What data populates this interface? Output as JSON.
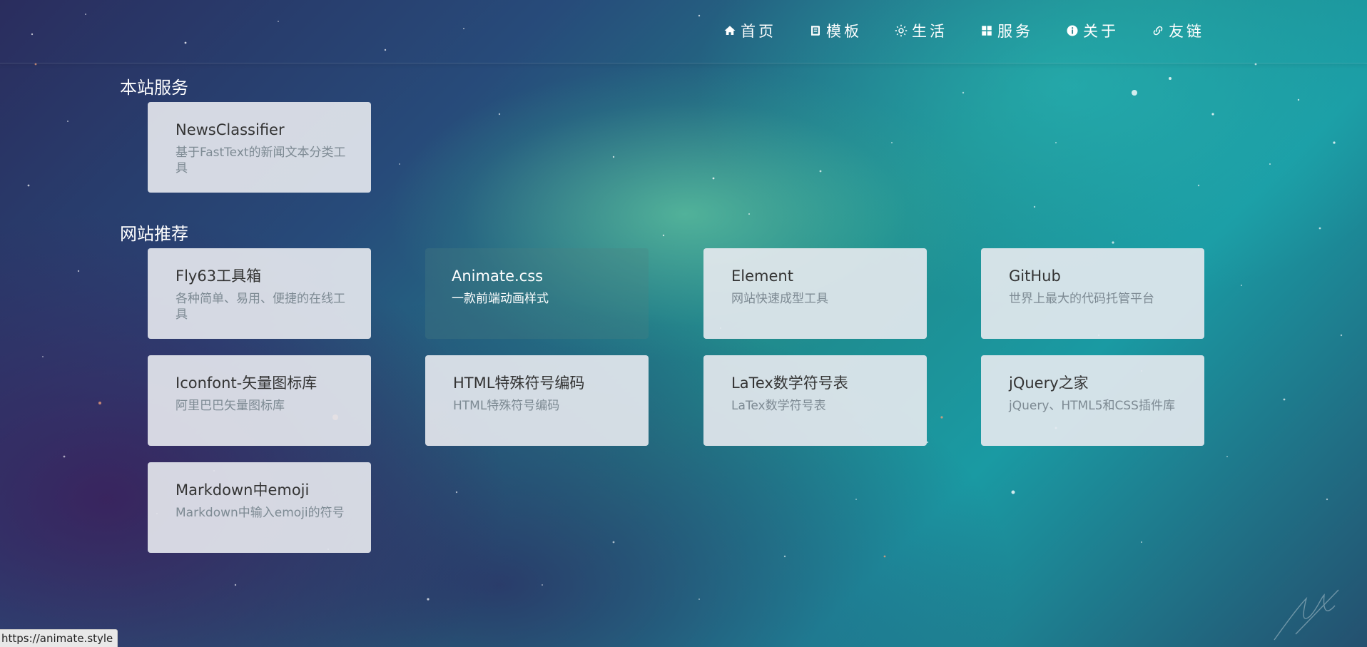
{
  "nav": [
    {
      "label": "首页",
      "icon": "home-icon"
    },
    {
      "label": "模板",
      "icon": "template-icon"
    },
    {
      "label": "生活",
      "icon": "sun-icon"
    },
    {
      "label": "服务",
      "icon": "grid-icon"
    },
    {
      "label": "关于",
      "icon": "info-icon"
    },
    {
      "label": "友链",
      "icon": "link-icon"
    }
  ],
  "sections": {
    "own": {
      "title": "本站服务",
      "cards": [
        {
          "title": "NewsClassifier",
          "desc": "基于FastText的新闻文本分类工具"
        }
      ]
    },
    "recommend": {
      "title": "网站推荐",
      "cards": [
        {
          "title": "Fly63工具箱",
          "desc": "各种简单、易用、便捷的在线工具"
        },
        {
          "title": "Animate.css",
          "desc": "一款前端动画样式"
        },
        {
          "title": "Element",
          "desc": "网站快速成型工具"
        },
        {
          "title": "GitHub",
          "desc": "世界上最大的代码托管平台"
        },
        {
          "title": "Iconfont-矢量图标库",
          "desc": "阿里巴巴矢量图标库"
        },
        {
          "title": "HTML特殊符号编码",
          "desc": "HTML特殊符号编码"
        },
        {
          "title": "LaTex数学符号表",
          "desc": "LaTex数学符号表"
        },
        {
          "title": "jQuery之家",
          "desc": "jQuery、HTML5和CSS插件库"
        },
        {
          "title": "Markdown中emoji",
          "desc": "Markdown中输入emoji的符号"
        }
      ]
    }
  },
  "status_url": "https://animate.style",
  "colors": {
    "card_bg": "#e8eaf0",
    "card_title": "#333333",
    "card_desc": "#7d8a93"
  }
}
